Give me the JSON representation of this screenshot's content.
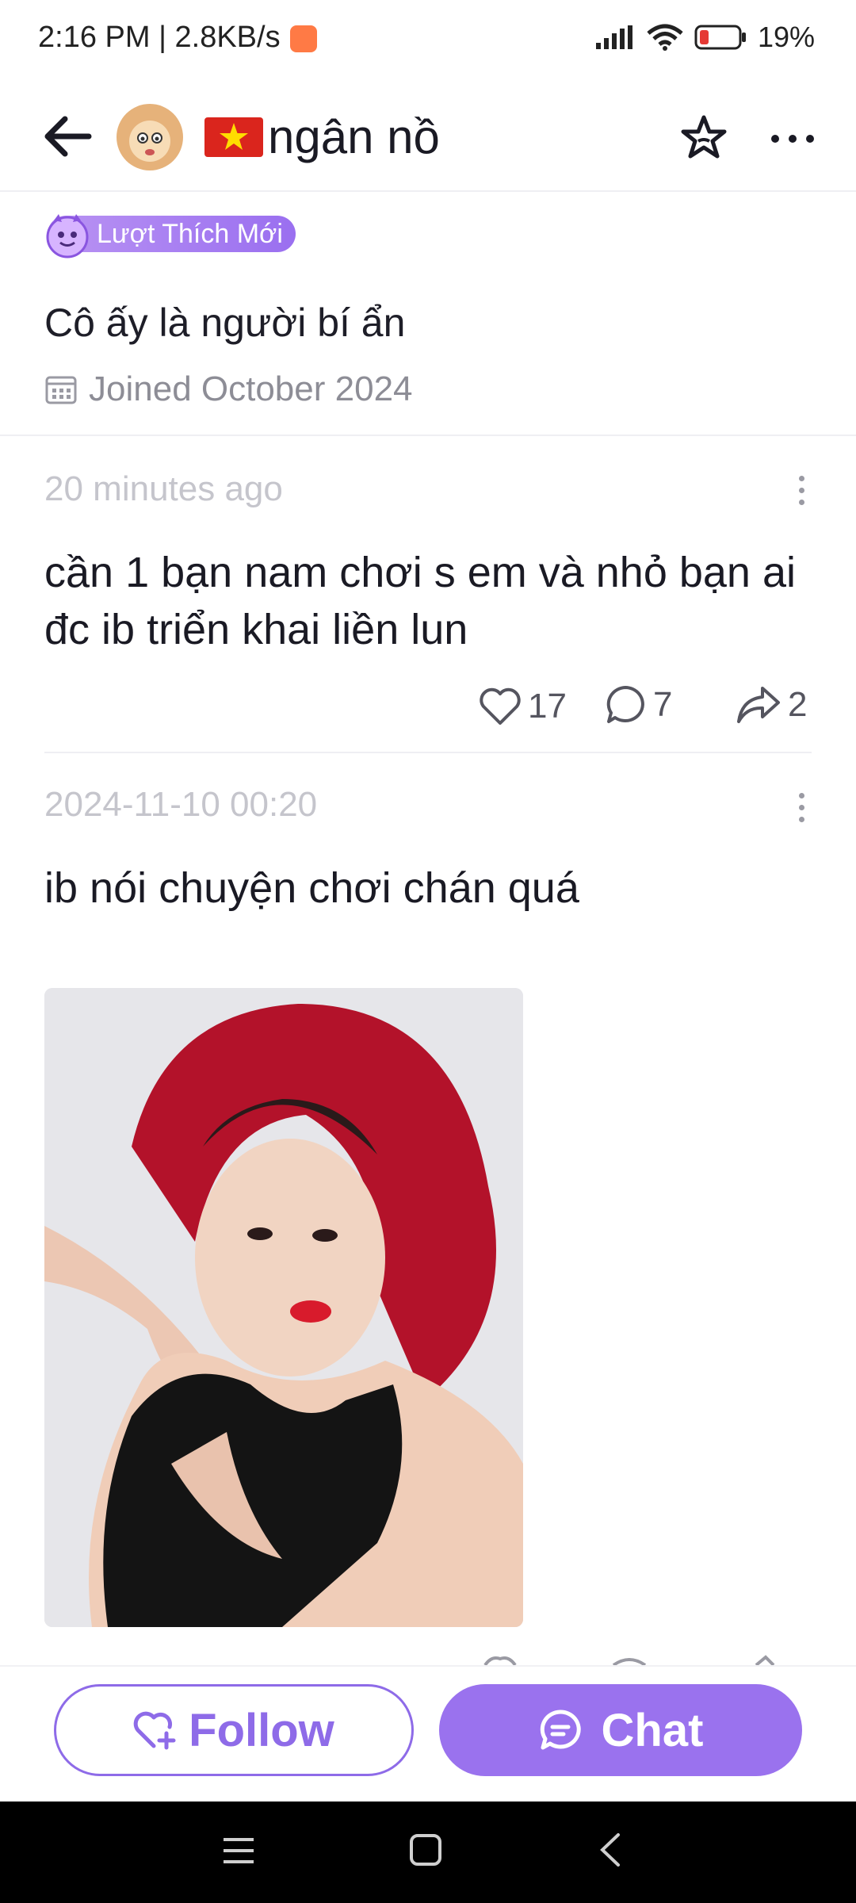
{
  "status_bar": {
    "time_speed": "2:16 PM | 2.8KB/s",
    "battery": "19%"
  },
  "header": {
    "username": "ngân nồ",
    "back_icon": "arrow-left-icon",
    "favorite_icon": "star-icon",
    "more_icon": "more-horizontal-icon"
  },
  "profile": {
    "badge": "Lượt Thích Mới",
    "bio": "Cô ấy là người bí ẩn",
    "joined": "Joined October 2024"
  },
  "posts": [
    {
      "time": "20 minutes ago",
      "text": "cần 1 bạn nam chơi s em và nhỏ bạn ai đc ib triển khai liền lun",
      "likes": "17",
      "comments": "7",
      "shares": "2"
    },
    {
      "time": "2024-11-10 00:20",
      "text": "ib nói chuyện chơi chán quá",
      "has_image": true
    }
  ],
  "actions": {
    "follow": "Follow",
    "chat": "Chat"
  },
  "colors": {
    "accent": "#9a72ee",
    "follow_border": "#8e6be8",
    "badge_gradient": [
      "#b993f3",
      "#9a6ff0"
    ],
    "muted_text": "#8d8d96"
  }
}
